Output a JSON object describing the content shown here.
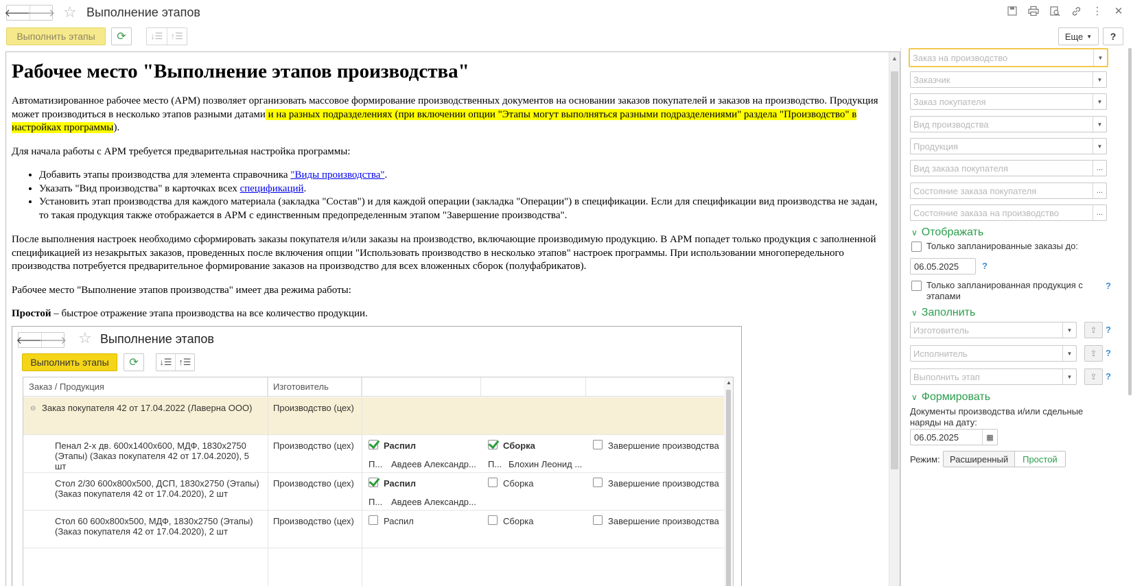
{
  "window": {
    "title": "Выполнение этапов",
    "back_icon": "🡐",
    "forward_icon": "🡒",
    "icons": [
      "save-icon",
      "print-icon",
      "preview-icon",
      "link-icon",
      "menu-dots-icon",
      "close-icon"
    ]
  },
  "toolbar": {
    "execute_label": "Выполнить этапы",
    "more_label": "Еще",
    "help_label": "?"
  },
  "doc": {
    "heading": "Рабочее место \"Выполнение этапов производства\"",
    "p1_a": "Автоматизированное рабочее место (АРМ) позволяет организовать массовое формирование производственных документов на основании заказов покупателей и заказов на производство. Продукция может производиться в несколько этапов разными датами",
    "p1_hl_a": " и на разных подразделениях (при включении опции \"Этапы могут выполняться разными подразделениями\" раздела \"Производство\" в настройках программы",
    "p1_end": ").",
    "p2": "Для начала работы с АРМ требуется предварительная настройка программы:",
    "li1_a": "Добавить этапы производства для элемента справочника ",
    "li1_link": "\"Виды производства\"",
    "li1_b": ".",
    "li2_a": "Указать \"Вид производства\" в карточках всех ",
    "li2_link": "спецификаций",
    "li2_b": ".",
    "li3": "Установить этап производства для каждого материала  (закладка \"Состав\") и для каждой операции  (закладка \"Операции\") в спецификации. Если для спецификации вид производства не задан, то такая продукция также отображается в АРМ с единственным предопределенным этапом \"Завершение производства\".",
    "p3": "После выполнения настроек необходимо сформировать заказы покупателя и/или заказы на производство, включающие производимую продукцию. В АРМ попадет только продукция с заполненной спецификацией из незакрытых заказов, проведенных после включения опции \"Использовать производство в несколько этапов\" настроек программы. При использовании многопередельного производства потребуется предварительное формирование заказов на производство для всех вложенных сборок (полуфабрикатов).",
    "p4": "Рабочее место \"Выполнение этапов производства\" имеет два режима работы:",
    "p5_bold": "Простой",
    "p5_rest": " – быстрое отражение этапа производства на все количество продукции."
  },
  "embedded": {
    "title": "Выполнение этапов",
    "execute_label": "Выполнить этапы",
    "columns": [
      "Заказ / Продукция",
      "Изготовитель"
    ],
    "group_row": {
      "order": "Заказ покупателя 42 от 17.04.2022  (Лаверна ООО)",
      "maker": "Производство (цех)"
    },
    "rows": [
      {
        "product": "Пенал 2-х дв. 600х1400х600, МДФ, 1830х2750 (Этапы) (Заказ покупателя 42 от 17.04.2020), 5 шт",
        "maker": "Производство (цех)",
        "stage1": "Распил",
        "stage1_checked": true,
        "stage2": "Сборка",
        "stage2_checked": true,
        "stage3": "Завершение производства",
        "stage3_checked": false,
        "exec1_prefix": "П...",
        "exec1": "Авдеев Александр...",
        "exec2_prefix": "П...",
        "exec2": "Блохин Леонид ..."
      },
      {
        "product": "Стол 2/30 600х800х500, ДСП, 1830х2750 (Этапы) (Заказ покупателя 42 от 17.04.2020), 2 шт",
        "maker": "Производство (цех)",
        "stage1": "Распил",
        "stage1_checked": true,
        "stage2": "Сборка",
        "stage2_checked": false,
        "stage3": "Завершение производства",
        "stage3_checked": false,
        "exec1_prefix": "П...",
        "exec1": "Авдеев Александр..."
      },
      {
        "product": "Стол 60 600х800х500, МДФ, 1830х2750 (Этапы) (Заказ покупателя 42 от 17.04.2020), 2 шт",
        "maker": "Производство (цех)",
        "stage1": "Распил",
        "stage1_checked": false,
        "stage2": "Сборка",
        "stage2_checked": false,
        "stage3": "Завершение производства",
        "stage3_checked": false
      }
    ]
  },
  "filters": {
    "order_production": "Заказ на производство",
    "customer": "Заказчик",
    "customer_order": "Заказ покупателя",
    "production_type": "Вид производства",
    "product": "Продукция",
    "customer_order_type": "Вид заказа покупателя",
    "customer_order_state": "Состояние заказа покупателя",
    "production_order_state": "Состояние заказа на производство"
  },
  "display": {
    "section_label": "Отображать",
    "only_planned_orders": "Только запланированные заказы до:",
    "date": "06.05.2025",
    "only_planned_products": "Только запланированная продукция с этапами"
  },
  "fill": {
    "section_label": "Заполнить",
    "maker": "Изготовитель",
    "executor": "Исполнитель",
    "stage": "Выполнить этап"
  },
  "form": {
    "section_label": "Формировать",
    "docs_label": "Документы производства и/или сдельные наряды на дату:",
    "date": "06.05.2025",
    "mode_label": "Режим:",
    "mode_extended": "Расширенный",
    "mode_simple": "Простой"
  },
  "colors": {
    "accent_green": "#2a9d4c",
    "yellow_button": "#f5d517",
    "highlight": "#ffff00",
    "group_row_bg": "#f7f0d6"
  }
}
